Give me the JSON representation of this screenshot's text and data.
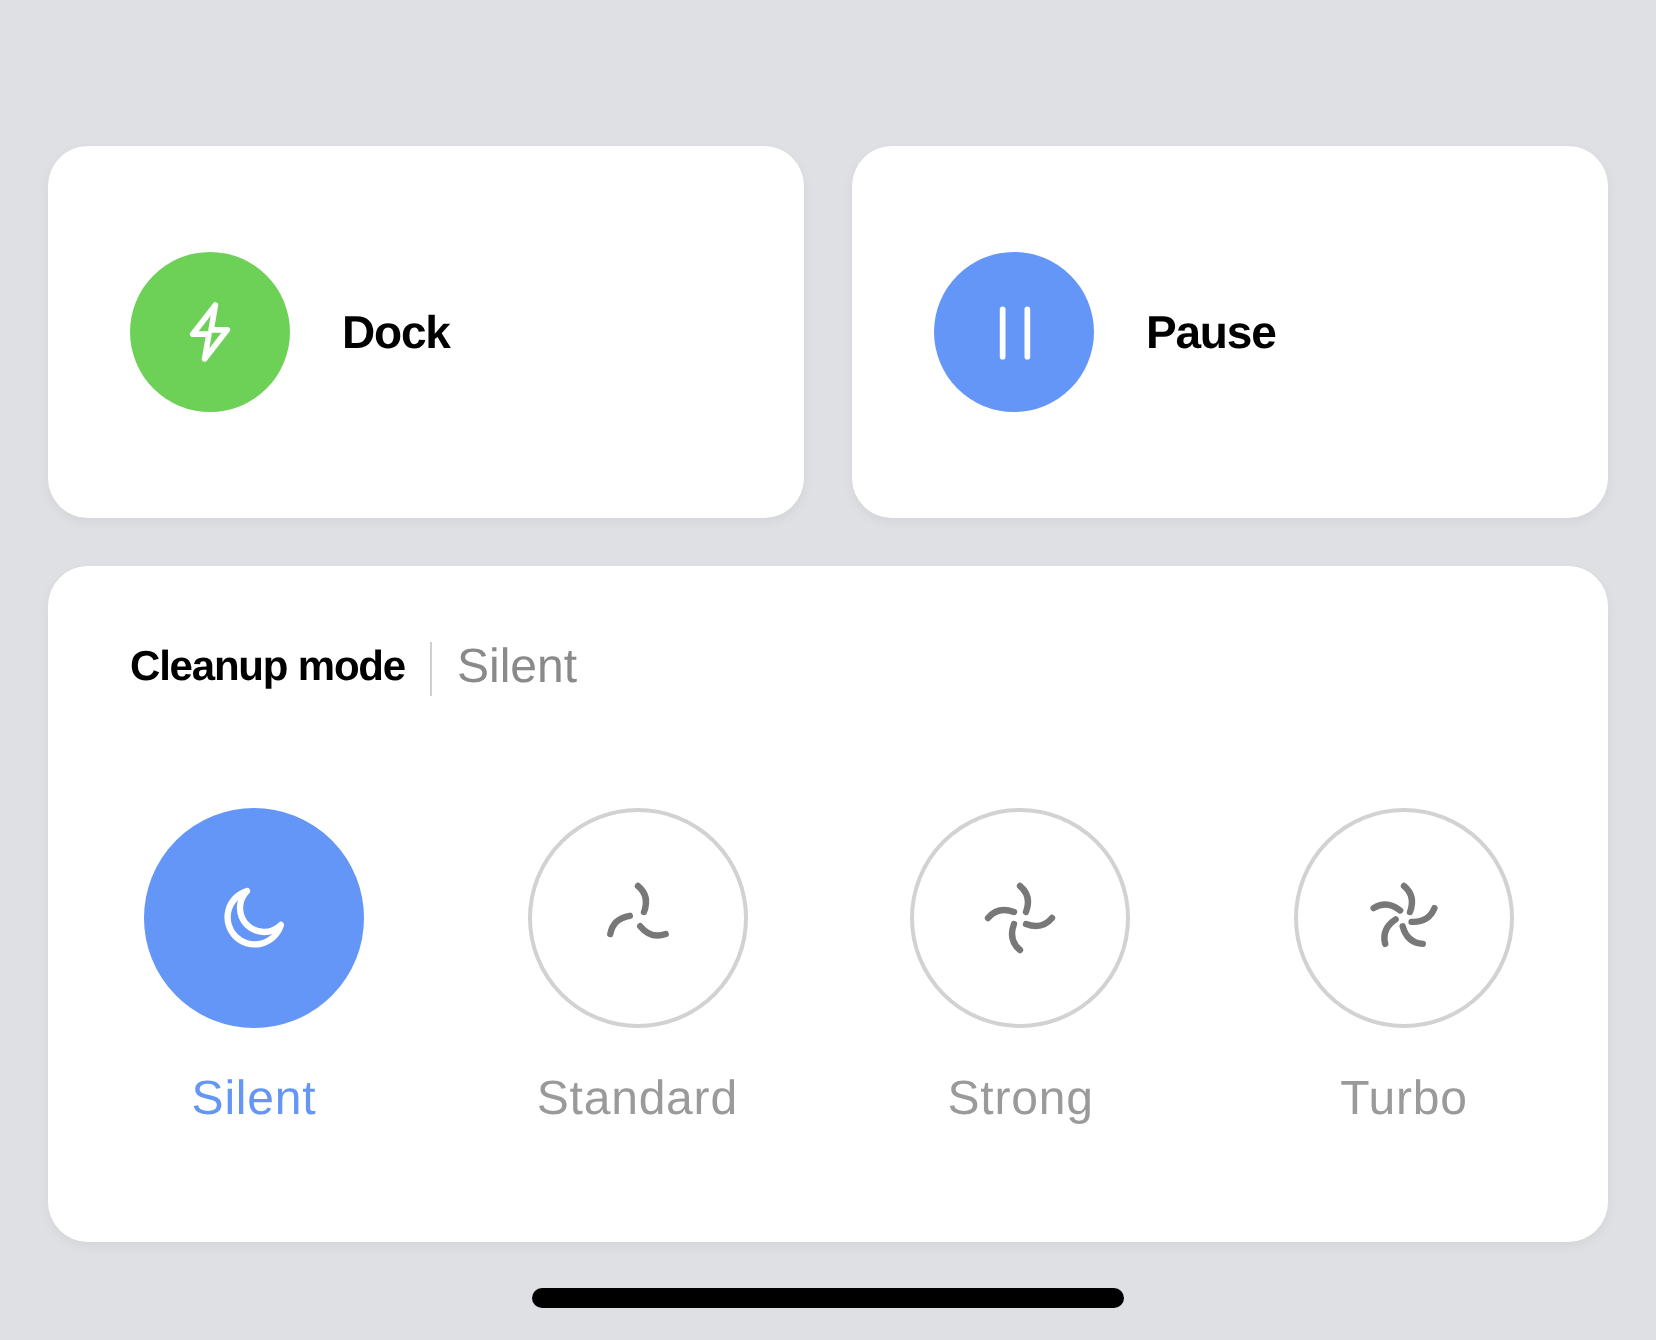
{
  "actions": [
    {
      "label": "Dock",
      "kind": "dock",
      "color": "#6dd158"
    },
    {
      "label": "Pause",
      "kind": "pause",
      "color": "#6496f7"
    }
  ],
  "cleanup_mode": {
    "title": "Cleanup mode",
    "current": "Silent",
    "modes": [
      {
        "label": "Silent",
        "kind": "moon",
        "selected": true
      },
      {
        "label": "Standard",
        "kind": "fan3",
        "selected": false
      },
      {
        "label": "Strong",
        "kind": "fan4",
        "selected": false
      },
      {
        "label": "Turbo",
        "kind": "fan5",
        "selected": false
      }
    ]
  }
}
